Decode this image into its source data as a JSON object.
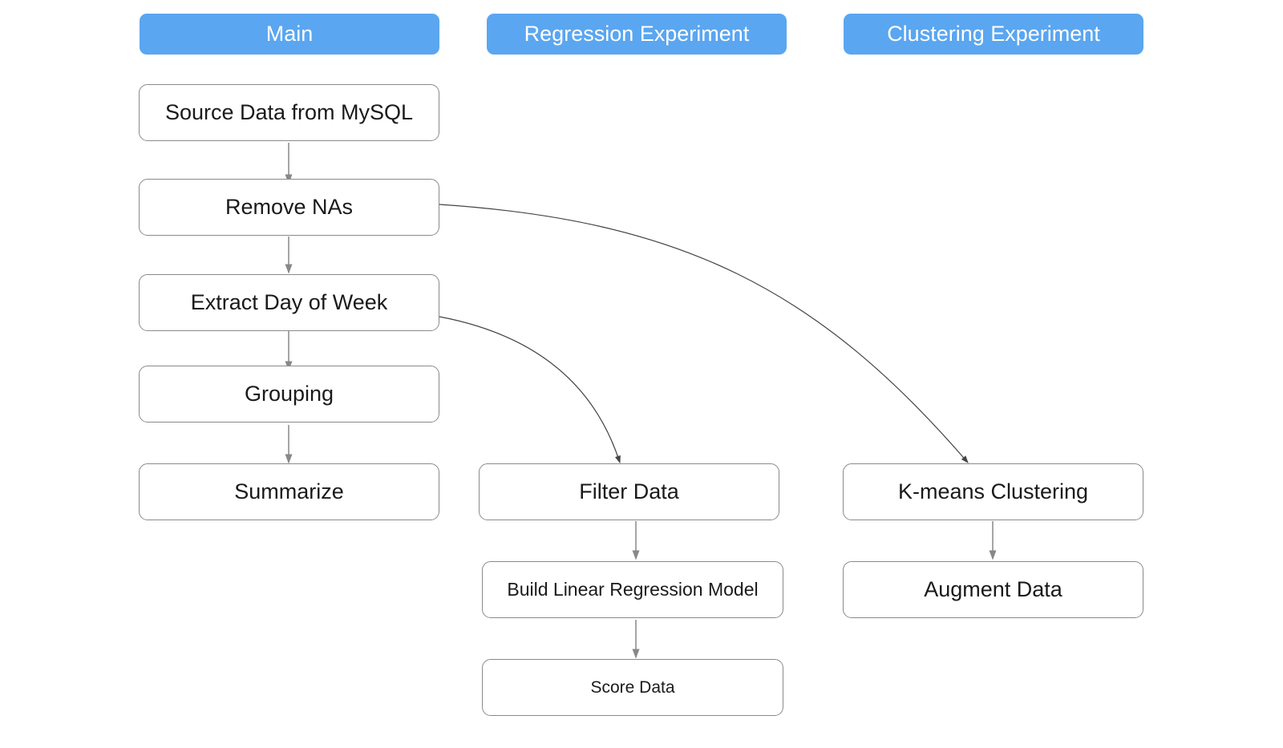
{
  "headers": {
    "main": "Main",
    "regression": "Regression Experiment",
    "clustering": "Clustering Experiment"
  },
  "nodes": {
    "source_data": "Source Data from MySQL",
    "remove_nas": "Remove NAs",
    "extract_dow": "Extract Day of Week",
    "grouping": "Grouping",
    "summarize": "Summarize",
    "filter_data": "Filter Data",
    "build_lr": "Build Linear Regression Model",
    "score_data": "Score Data",
    "kmeans": "K-means Clustering",
    "augment": "Augment Data"
  },
  "edges": [
    {
      "from": "source_data",
      "to": "remove_nas"
    },
    {
      "from": "remove_nas",
      "to": "extract_dow"
    },
    {
      "from": "extract_dow",
      "to": "grouping"
    },
    {
      "from": "grouping",
      "to": "summarize"
    },
    {
      "from": "extract_dow",
      "to": "filter_data"
    },
    {
      "from": "remove_nas",
      "to": "kmeans"
    },
    {
      "from": "filter_data",
      "to": "build_lr"
    },
    {
      "from": "build_lr",
      "to": "score_data"
    },
    {
      "from": "kmeans",
      "to": "augment"
    }
  ],
  "colors": {
    "header": "#5aa6f0",
    "border": "#8a8a8a",
    "edge": "#777777"
  }
}
